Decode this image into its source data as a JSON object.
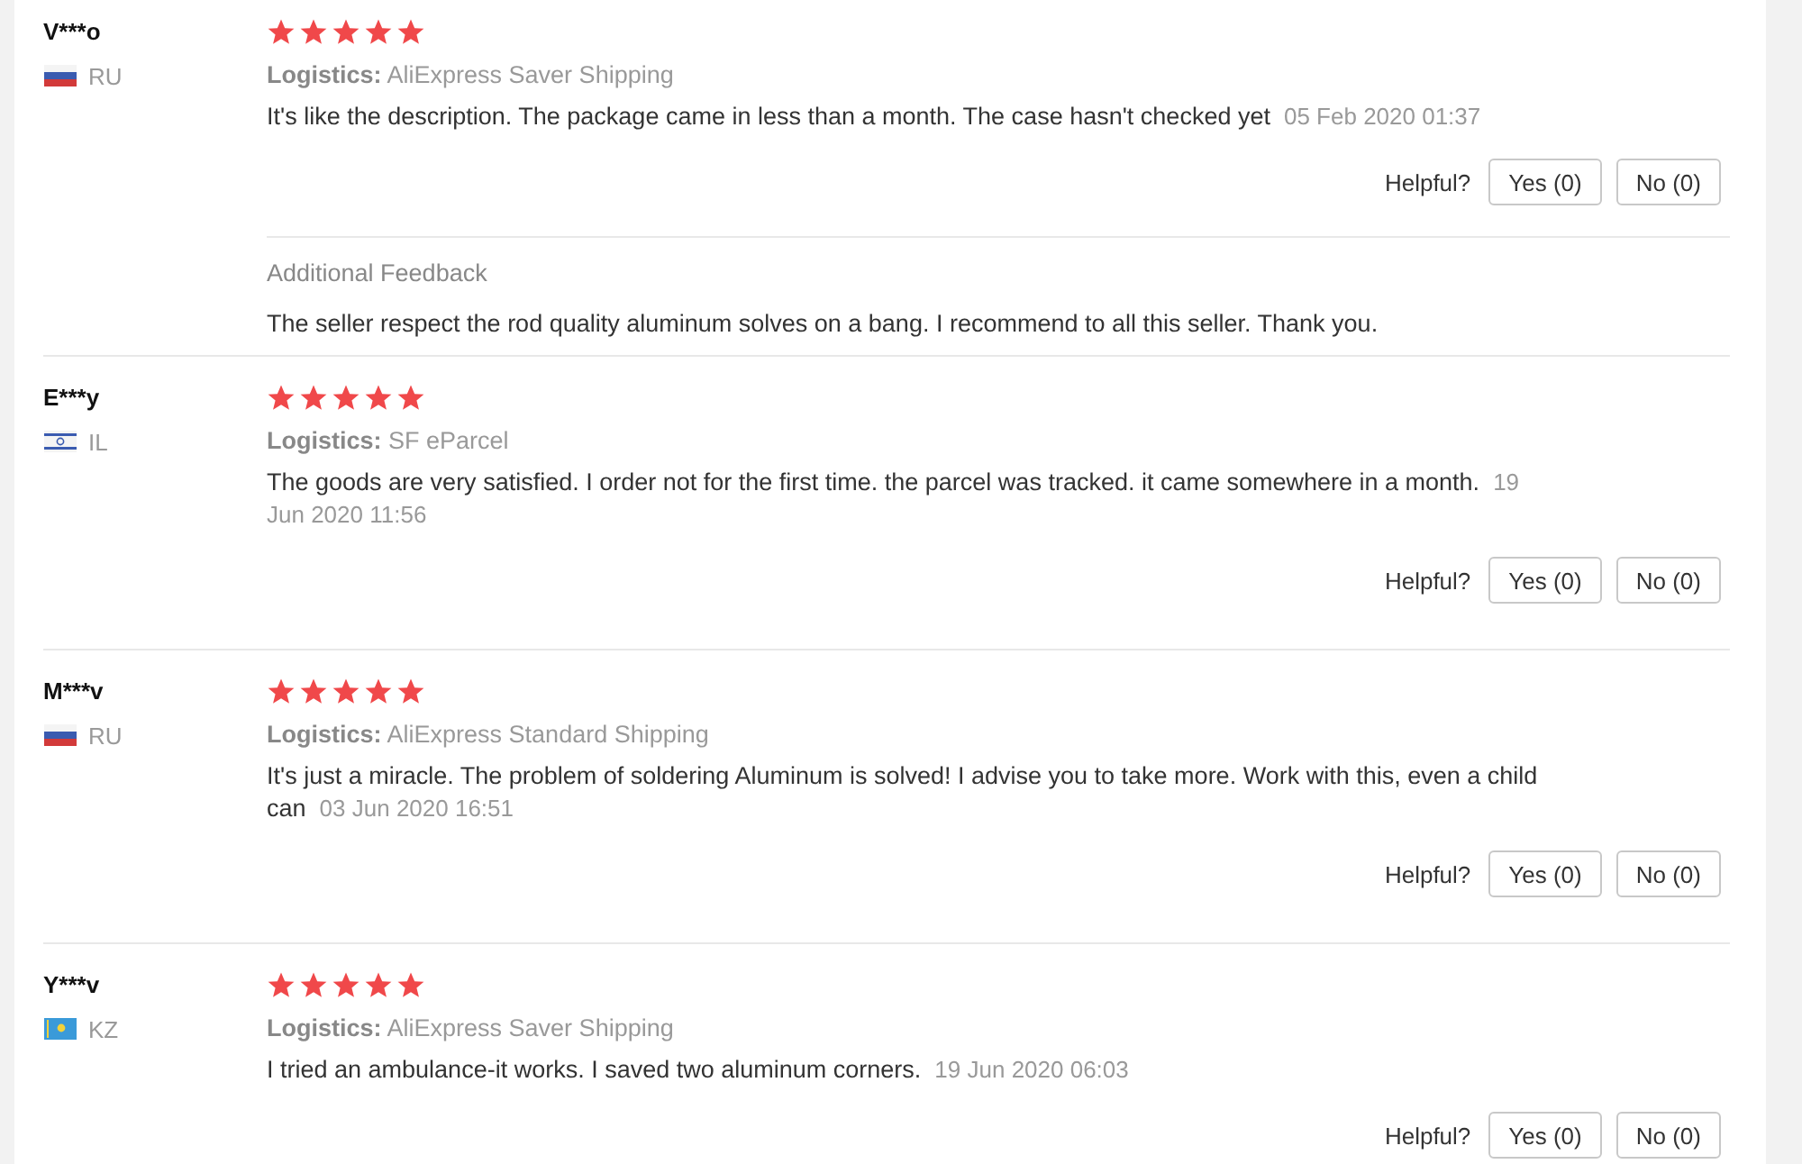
{
  "reviews": [
    {
      "name": "V***o",
      "kind": "ru",
      "country": "RU",
      "stars": 5,
      "logistics": "**Logistics:** AliExpress Saver Shipping",
      "text": "It's like the description. The package came in less than a month. The case hasn't checked yet",
      "date": "05 Feb 2020 01:37",
      "helpful_label": "Helpful?",
      "yes": "Yes (0)",
      "no": "No (0)",
      "additional": {
        "title": "Additional Feedback",
        "text": "The seller respect the rod quality aluminum solves on a bang. I recommend to all this seller. Thank you."
      }
    },
    {
      "name": "E***y",
      "kind": "il",
      "country": "IL",
      "stars": 5,
      "logistics": "**Logistics:** SF eParcel",
      "text": "The goods are very satisfied. I order not for the first time. the parcel was tracked. it came somewhere in a month.",
      "date": "19 Jun 2020 11:56",
      "helpful_label": "Helpful?",
      "yes": "Yes (0)",
      "no": "No (0)"
    },
    {
      "name": "M***v",
      "kind": "ru",
      "country": "RU",
      "stars": 5,
      "logistics": "**Logistics:** AliExpress Standard Shipping",
      "text": "It's just a miracle. The problem of soldering Aluminum is solved! I advise you to take more. Work with this, even a child can",
      "date": "03 Jun 2020 16:51",
      "helpful_label": "Helpful?",
      "yes": "Yes (0)",
      "no": "No (0)"
    },
    {
      "name": "Y***v",
      "kind": "kz",
      "country": "KZ",
      "stars": 5,
      "logistics": "**Logistics:** AliExpress Saver Shipping",
      "text": "I tried an ambulance-it works. I saved two aluminum corners.",
      "date": "19 Jun 2020 06:03",
      "helpful_label": "Helpful?",
      "yes": "Yes (0)",
      "no": "No (0)"
    }
  ]
}
